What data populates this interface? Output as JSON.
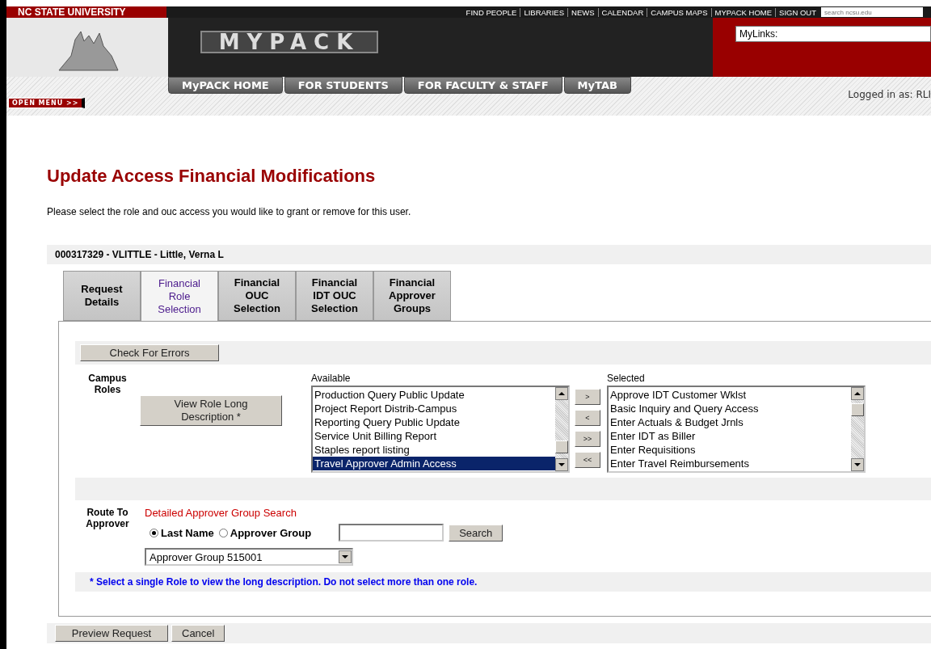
{
  "header": {
    "brand": "NC STATE UNIVERSITY",
    "links": [
      "FIND PEOPLE",
      "LIBRARIES",
      "NEWS",
      "CALENDAR",
      "CAMPUS MAPS",
      "MYPACK HOME",
      "SIGN OUT"
    ],
    "search": {
      "placeholder": "search ncsu.edu"
    },
    "logo": "MYPACK",
    "mylinks": "MyLinks:",
    "nav": [
      {
        "label": "MyPACK HOME"
      },
      {
        "label": "FOR STUDENTS"
      },
      {
        "label": "FOR FACULTY & STAFF"
      },
      {
        "label": "MyTAB"
      }
    ],
    "open_menu": "OPEN MENU >>",
    "logged_in": "Logged in as: RLI"
  },
  "page": {
    "title": "Update Access Financial Modifications",
    "description": "Please select the role and ouc access you would like to grant or remove for this user.",
    "user": "000317329 - VLITTLE - Little, Verna L"
  },
  "tabs": [
    {
      "label": "Request Details",
      "selected": false
    },
    {
      "label": "Financial Role Selection",
      "selected": true
    },
    {
      "label": "Financial OUC Selection",
      "selected": false
    },
    {
      "label": "Financial IDT OUC Selection",
      "selected": false
    },
    {
      "label": "Financial Approver Groups",
      "selected": false
    }
  ],
  "check_button": "Check For Errors",
  "roles": {
    "label": "Campus Roles",
    "view_button": "View Role Long Description *",
    "available_label": "Available",
    "selected_label": "Selected",
    "available": [
      {
        "label": "Production Query Public Update",
        "selected": false
      },
      {
        "label": "Project Report Distrib-Campus",
        "selected": false
      },
      {
        "label": "Reporting Query Public Update",
        "selected": false
      },
      {
        "label": "Service Unit Billing Report",
        "selected": false
      },
      {
        "label": "Staples report listing",
        "selected": false
      },
      {
        "label": "Travel Approver Admin Access",
        "selected": true
      }
    ],
    "move_buttons": [
      ">",
      "<",
      ">>",
      "<<"
    ],
    "selected": [
      {
        "label": "Approve IDT Customer Wklst",
        "selected": false
      },
      {
        "label": "Basic Inquiry and Query Access",
        "selected": false
      },
      {
        "label": "Enter Actuals & Budget Jrnls",
        "selected": false
      },
      {
        "label": "Enter IDT as Biller",
        "selected": false
      },
      {
        "label": "Enter Requisitions",
        "selected": false
      },
      {
        "label": "Enter Travel Reimbursements",
        "selected": false
      }
    ]
  },
  "route": {
    "label": "Route To Approver",
    "search_link": "Detailed Approver Group Search",
    "radios": [
      {
        "label": "Last Name",
        "selected": true
      },
      {
        "label": "Approver Group",
        "selected": false
      }
    ],
    "search_button": "Search",
    "group_select": "Approver Group 515001"
  },
  "note": "* Select a single Role to view the long description. Do not select more than one role.",
  "footer_buttons": [
    "Preview Request",
    "Cancel"
  ]
}
